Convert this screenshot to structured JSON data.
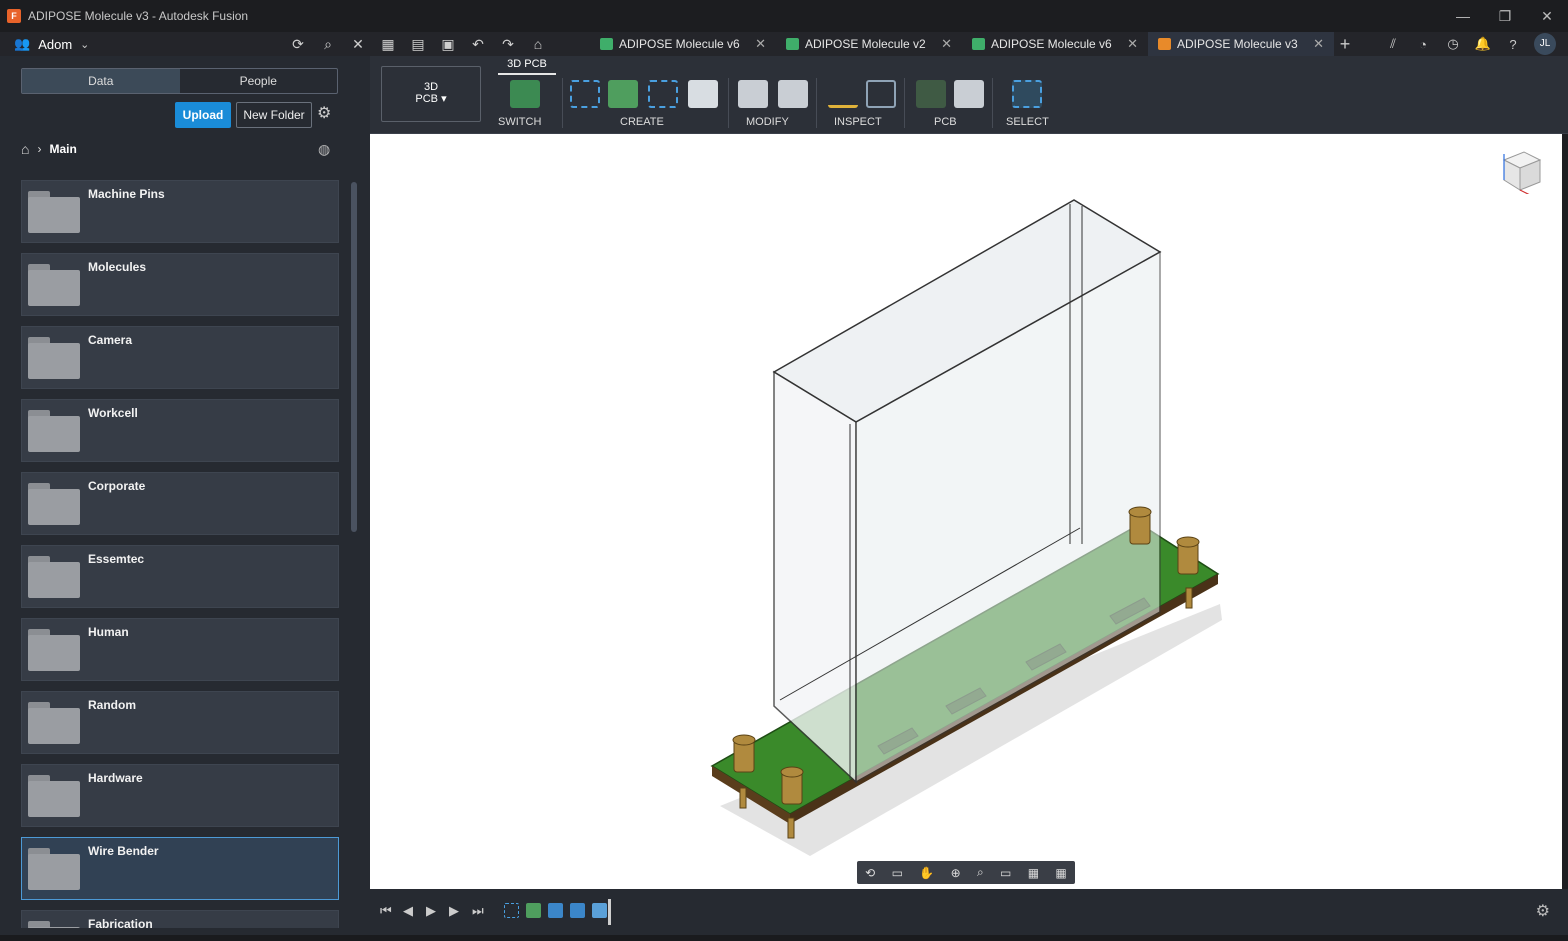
{
  "window": {
    "title": "ADIPOSE Molecule v3 - Autodesk Fusion",
    "controls": [
      "—",
      "❐",
      "✕"
    ]
  },
  "appbar": {
    "team_name": "Adom",
    "tabs": [
      {
        "label": "ADIPOSE Molecule v6",
        "icon": "pcb-green-icon"
      },
      {
        "label": "ADIPOSE Molecule v2",
        "icon": "schematic-green-icon"
      },
      {
        "label": "ADIPOSE Molecule v6",
        "icon": "pcb-green-icon"
      },
      {
        "label": "ADIPOSE Molecule v3",
        "icon": "3d-box-orange-icon",
        "active": true
      }
    ],
    "avatar": "JL"
  },
  "panel": {
    "segments": [
      "Data",
      "People"
    ],
    "active_segment": "Data",
    "upload_label": "Upload",
    "new_folder_label": "New Folder",
    "breadcrumb": "Main",
    "folders": [
      "Machine Pins",
      "Molecules",
      "Camera",
      "Workcell",
      "Corporate",
      "Essemtec",
      "Human",
      "Random",
      "Hardware",
      "Wire Bender",
      "Fabrication"
    ],
    "selected_folder": "Wire Bender"
  },
  "toolbar": {
    "workspace_line1": "3D",
    "workspace_line2": "PCB",
    "active_tab": "3D PCB",
    "groups": [
      "SWITCH",
      "CREATE",
      "MODIFY",
      "INSPECT",
      "PCB",
      "SELECT"
    ]
  },
  "colors": {
    "accent": "#1a8cd8",
    "pcb_green": "#3a8a2a",
    "pcb_dark": "#1f4d15",
    "brass": "#b08a3e",
    "selected_border": "#4d9ad6"
  }
}
